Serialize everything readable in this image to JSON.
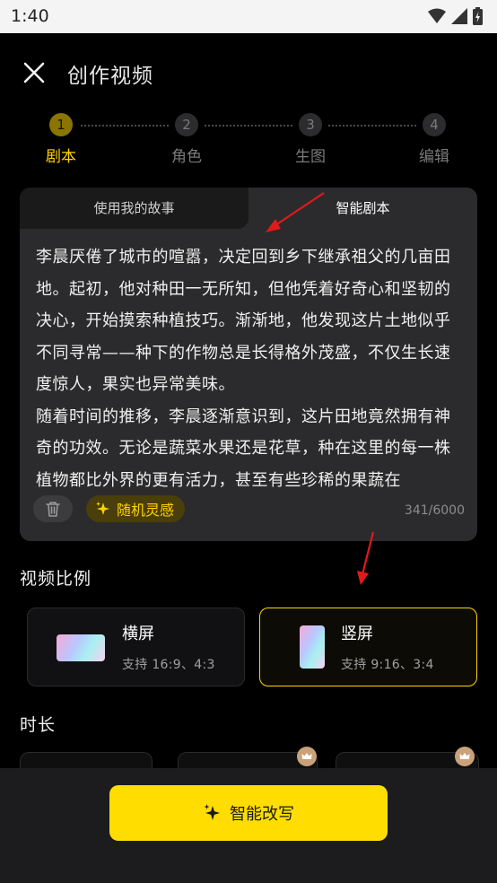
{
  "status_bar": {
    "time": "1:40"
  },
  "header": {
    "title": "创作视频"
  },
  "steps": [
    {
      "num": "1",
      "label": "剧本"
    },
    {
      "num": "2",
      "label": "角色"
    },
    {
      "num": "3",
      "label": "生图"
    },
    {
      "num": "4",
      "label": "编辑"
    }
  ],
  "tabs": {
    "left": "使用我的故事",
    "right": "智能剧本"
  },
  "story": {
    "paragraphs": [
      "李晨厌倦了城市的喧嚣，决定回到乡下继承祖父的几亩田地。起初，他对种田一无所知，但他凭着好奇心和坚韧的决心，开始摸索种植技巧。渐渐地，他发现这片土地似乎不同寻常——种下的作物总是长得格外茂盛，不仅生长速度惊人，果实也异常美味。",
      "随着时间的推移，李晨逐渐意识到，这片田地竟然拥有神奇的功效。无论是蔬菜水果还是花草，种在这里的每一株植物都比外界的更有活力，甚至有些珍稀的果蔬在"
    ],
    "inspire_label": "随机灵感",
    "char_count": "341/6000"
  },
  "ratio": {
    "title": "视频比例",
    "options": [
      {
        "name": "横屏",
        "desc": "支持 16:9、4:3"
      },
      {
        "name": "竖屏",
        "desc": "支持 9:16、3:4"
      }
    ]
  },
  "duration": {
    "title": "时长"
  },
  "bottom": {
    "button_label": "智能改写"
  },
  "colors": {
    "accent": "#ffdd00",
    "annotation_arrow": "#e01a1a"
  }
}
